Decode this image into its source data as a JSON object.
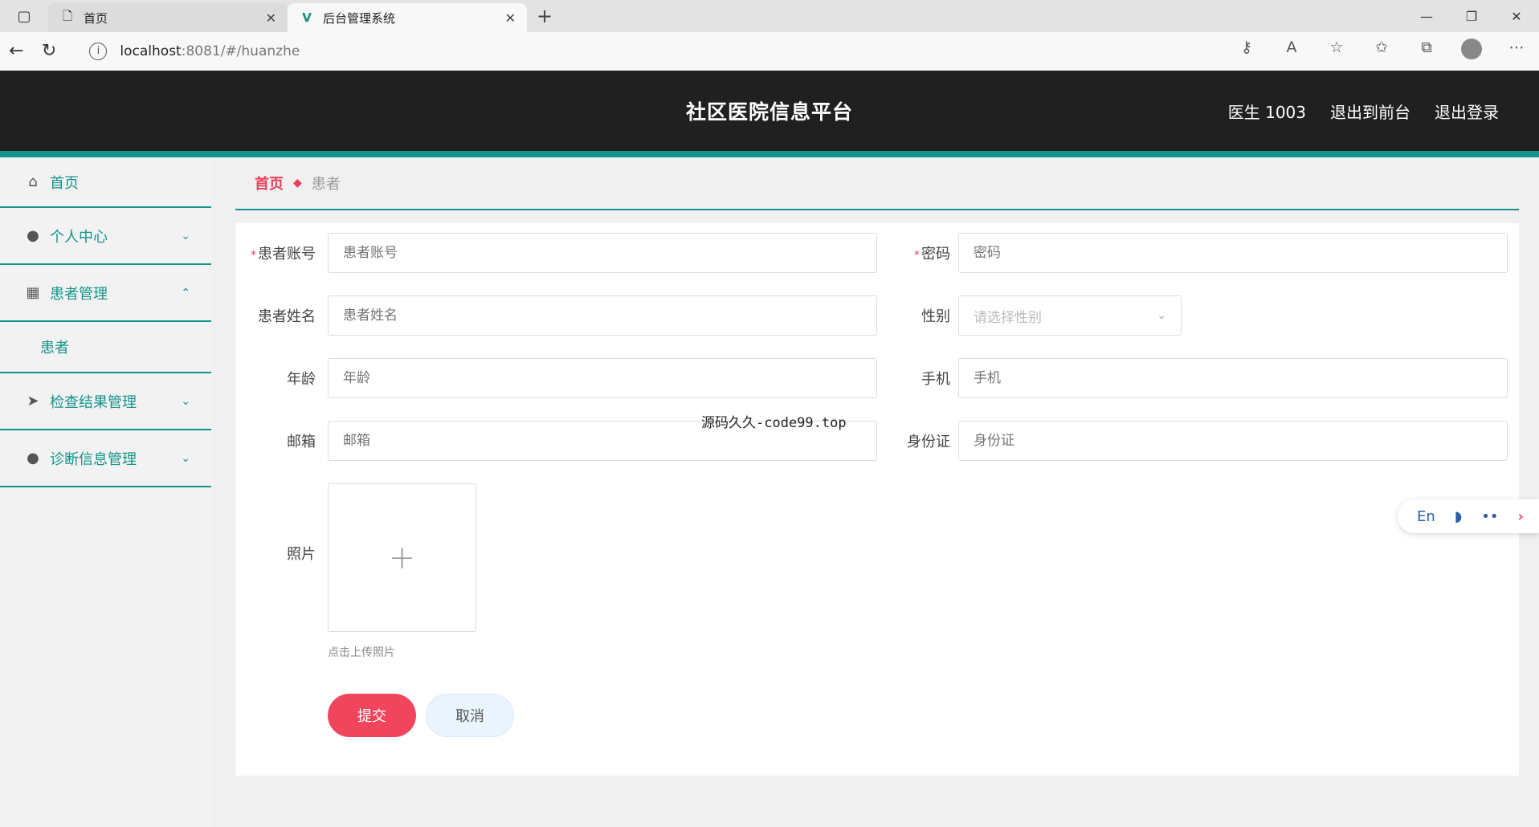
{
  "browser": {
    "tabs": [
      {
        "title": "首页",
        "active": false
      },
      {
        "title": "后台管理系统",
        "active": true
      }
    ],
    "url_host": "localhost",
    "url_path": ":8081/#/huanzhe"
  },
  "header": {
    "title": "社区医院信息平台",
    "user": "医生 1003",
    "to_front": "退出到前台",
    "logout": "退出登录"
  },
  "sidebar": {
    "items": [
      {
        "label": "首页",
        "icon": "home-icon"
      },
      {
        "label": "个人中心",
        "icon": "user-icon"
      },
      {
        "label": "患者管理",
        "icon": "grid-icon"
      },
      {
        "label": "检查结果管理",
        "icon": "send-icon"
      },
      {
        "label": "诊断信息管理",
        "icon": "user-icon"
      }
    ],
    "sub_patient": "患者"
  },
  "breadcrumb": {
    "home": "首页",
    "current": "患者"
  },
  "form": {
    "account_label": "患者账号",
    "account_placeholder": "患者账号",
    "password_label": "密码",
    "password_placeholder": "密码",
    "name_label": "患者姓名",
    "name_placeholder": "患者姓名",
    "gender_label": "性别",
    "gender_placeholder": "请选择性别",
    "age_label": "年龄",
    "age_placeholder": "年龄",
    "phone_label": "手机",
    "phone_placeholder": "手机",
    "email_label": "邮箱",
    "email_placeholder": "邮箱",
    "idcard_label": "身份证",
    "idcard_placeholder": "身份证",
    "photo_label": "照片",
    "photo_tip": "点击上传照片",
    "submit": "提交",
    "cancel": "取消"
  },
  "overlay_text": "源码久久-code99.top",
  "lang_widget": "En",
  "colors": {
    "accent": "#14948a",
    "primary": "#f0455d",
    "header_bg": "#202020"
  }
}
